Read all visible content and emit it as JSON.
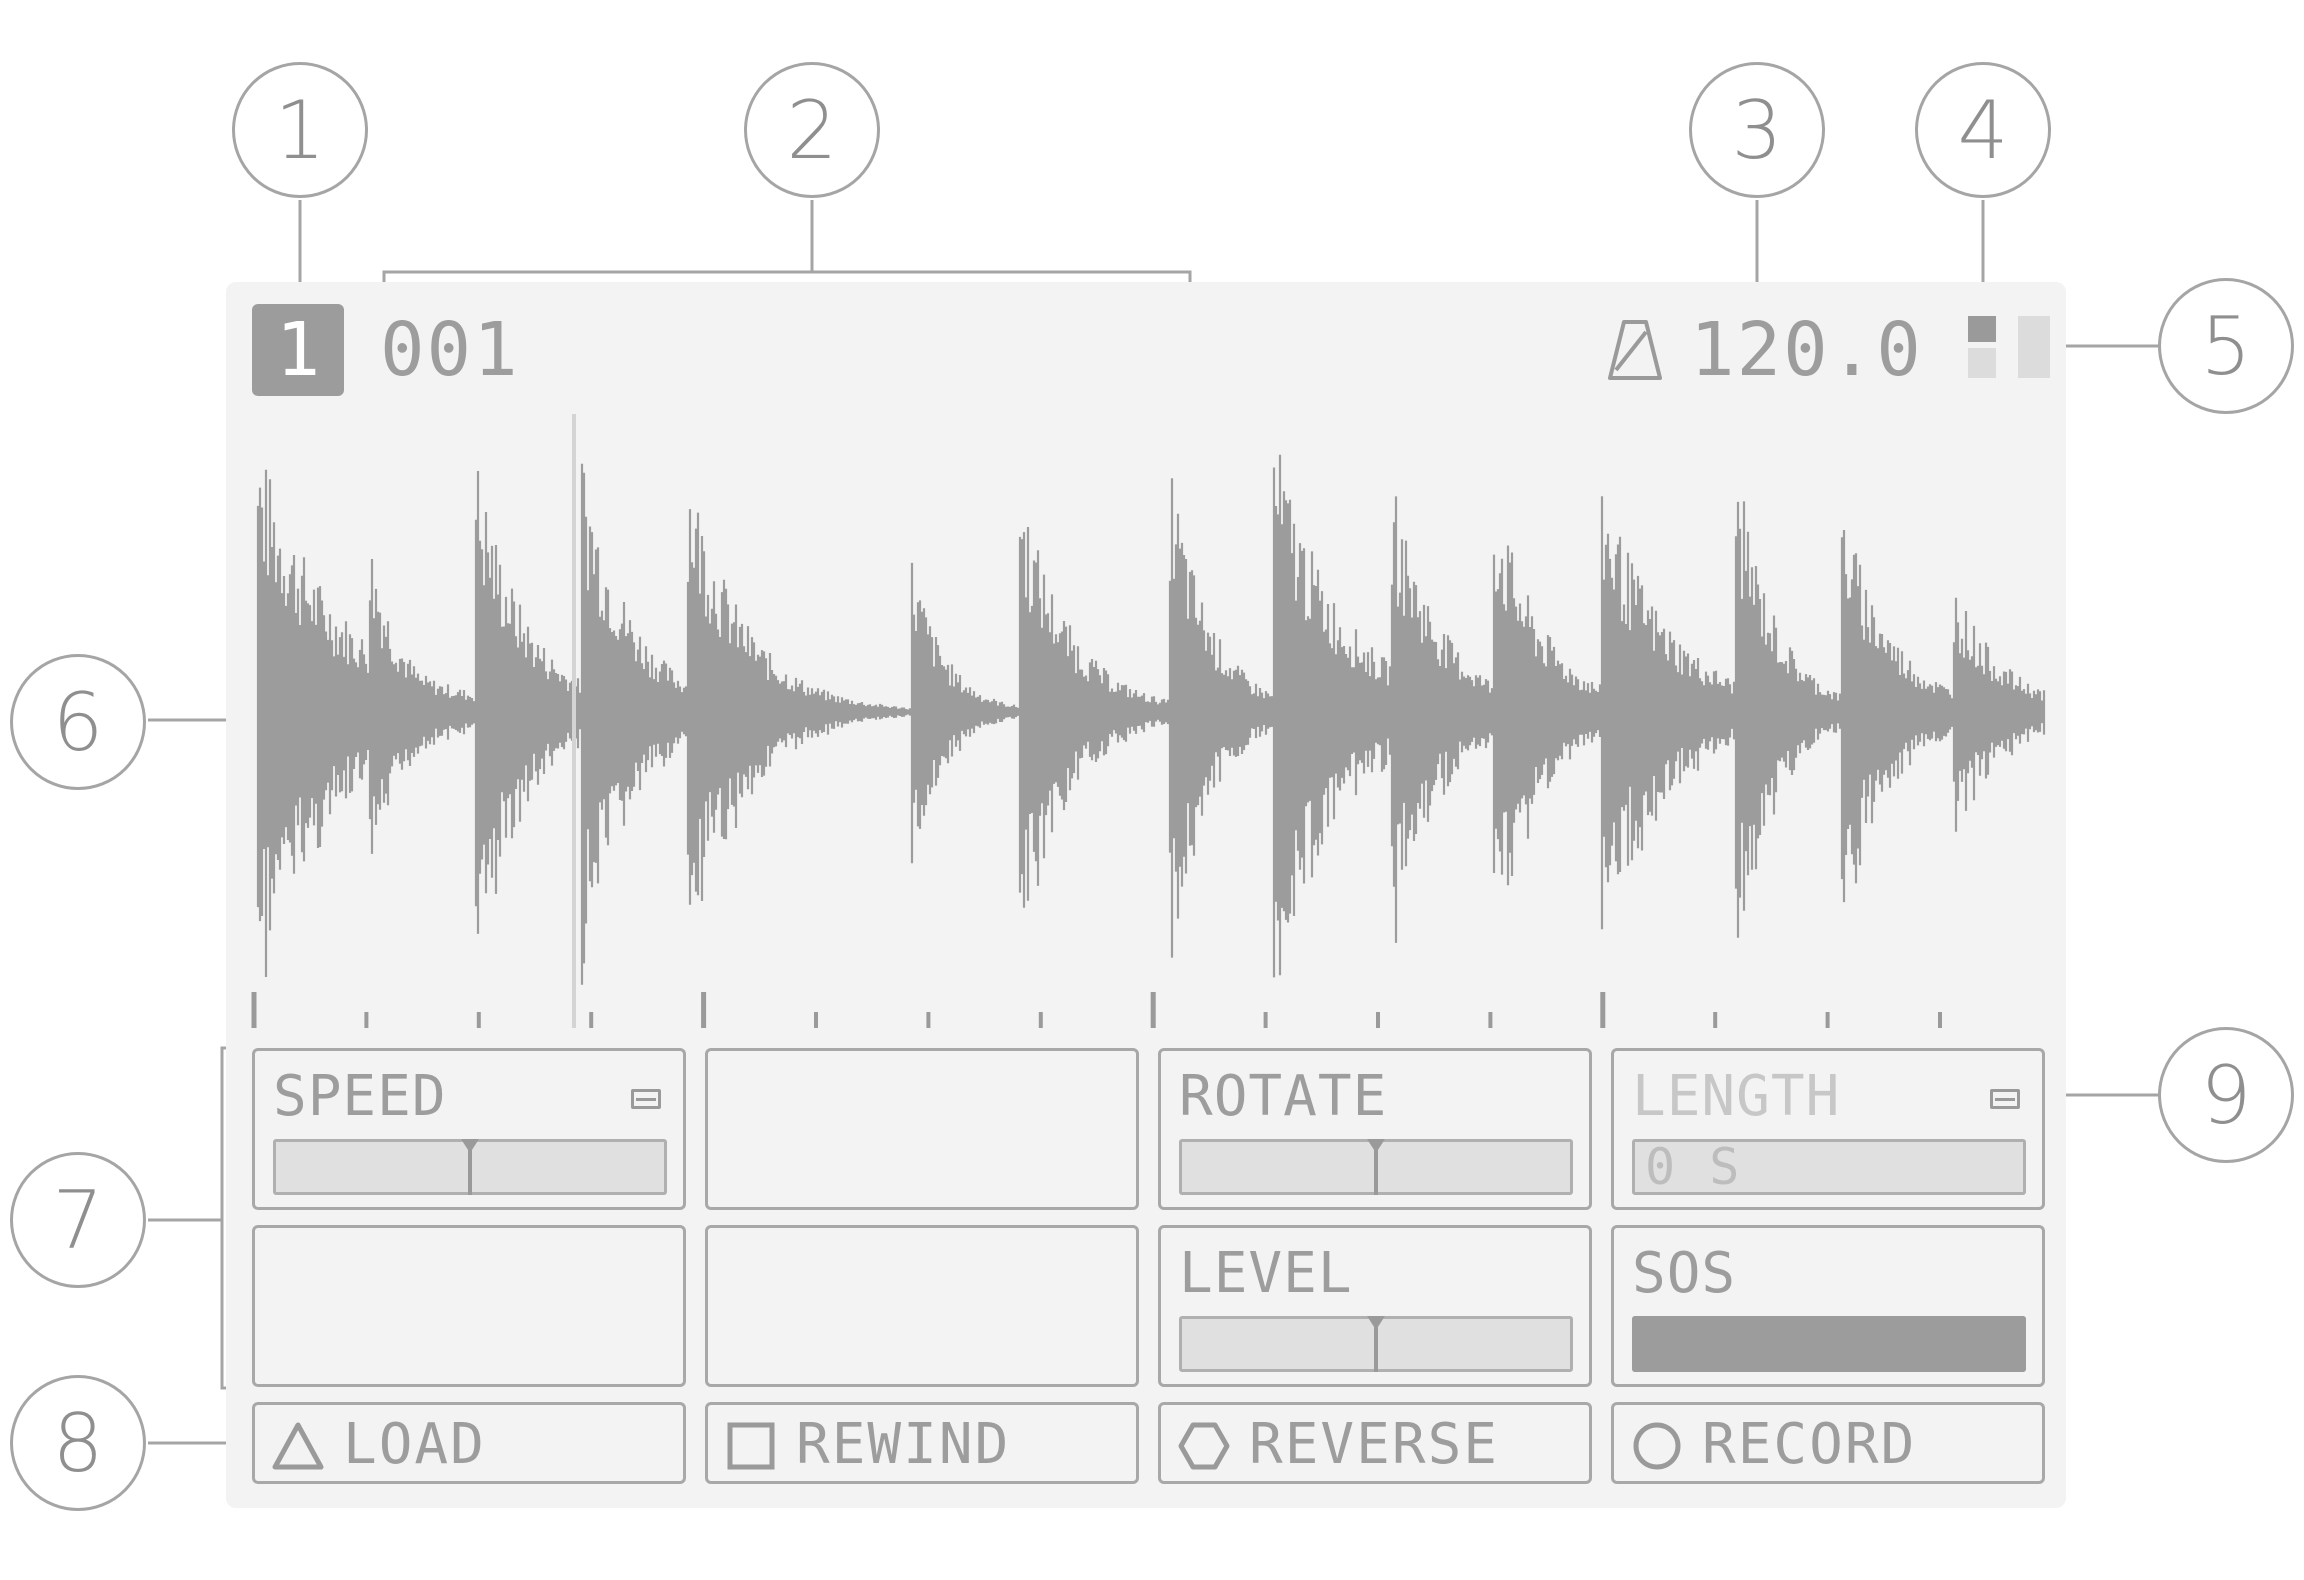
{
  "callouts": [
    "1",
    "2",
    "3",
    "4",
    "5",
    "6",
    "7",
    "8",
    "9"
  ],
  "header": {
    "track_number": "1",
    "project_number": "001",
    "tempo": "120.0"
  },
  "params": [
    {
      "label": "SPEED",
      "control": "bipolar-slider",
      "value": 0.5,
      "has_menu": true,
      "dimmed": false
    },
    {
      "label": "",
      "control": "empty",
      "has_menu": false,
      "dimmed": false
    },
    {
      "label": "ROTATE",
      "control": "bipolar-slider",
      "value": 0.5,
      "has_menu": false,
      "dimmed": false
    },
    {
      "label": "LENGTH",
      "control": "value-field",
      "display_value": "0 S",
      "has_menu": true,
      "dimmed": true
    },
    {
      "label": "",
      "control": "empty",
      "has_menu": false,
      "dimmed": false
    },
    {
      "label": "",
      "control": "empty",
      "has_menu": false,
      "dimmed": false
    },
    {
      "label": "LEVEL",
      "control": "bipolar-slider",
      "value": 0.5,
      "has_menu": false,
      "dimmed": false
    },
    {
      "label": "SOS",
      "control": "fill-bar",
      "value": 1.0,
      "has_menu": false,
      "dimmed": false
    }
  ],
  "softkeys": [
    {
      "label": "LOAD",
      "icon": "triangle-icon"
    },
    {
      "label": "REWIND",
      "icon": "square-icon"
    },
    {
      "label": "REVERSE",
      "icon": "hexagon-icon"
    },
    {
      "label": "RECORD",
      "icon": "circle-icon"
    }
  ],
  "colors": {
    "screen_bg": "#f3f3f3",
    "waveform": "#9c9c9c",
    "outline": "#a8a8a8",
    "text": "#9d9d9d",
    "dim_text": "#c7c7c7"
  }
}
